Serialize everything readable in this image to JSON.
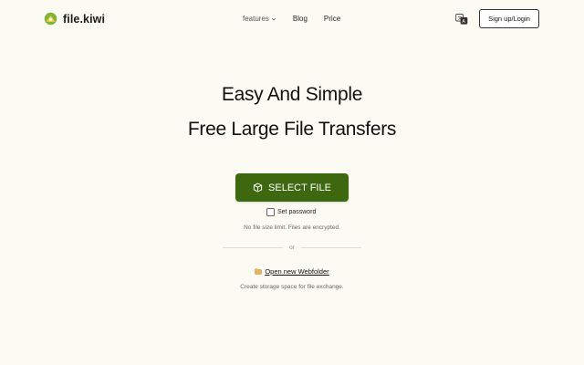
{
  "header": {
    "logo_text": "file.kiwi",
    "nav": {
      "features_label": "features",
      "blog_label": "Blog",
      "price_label": "Price"
    },
    "signup_label": "Sign up/Login"
  },
  "hero": {
    "title_line1": "Easy And Simple",
    "title_line2": "Free Large File Transfers",
    "select_button_label": "SELECT FILE",
    "set_password_label": "Set password",
    "set_password_checked": false,
    "limit_note": "No file size limit. Files are encrypted.",
    "divider_label": "or",
    "webfolder_link_label": "Open new Webfolder",
    "webfolder_note": "Create storage space for file exchange."
  },
  "colors": {
    "background": "#fbfbf4",
    "primary_button": "#3d6810",
    "logo_green": "#7fb63a",
    "logo_yellow": "#f2c84b"
  },
  "icons": {
    "logo": "kiwi-logo-icon",
    "features_chevron": "chevron-down-icon",
    "language": "translate-icon",
    "select_file": "box-icon",
    "webfolder": "folder-icon"
  }
}
